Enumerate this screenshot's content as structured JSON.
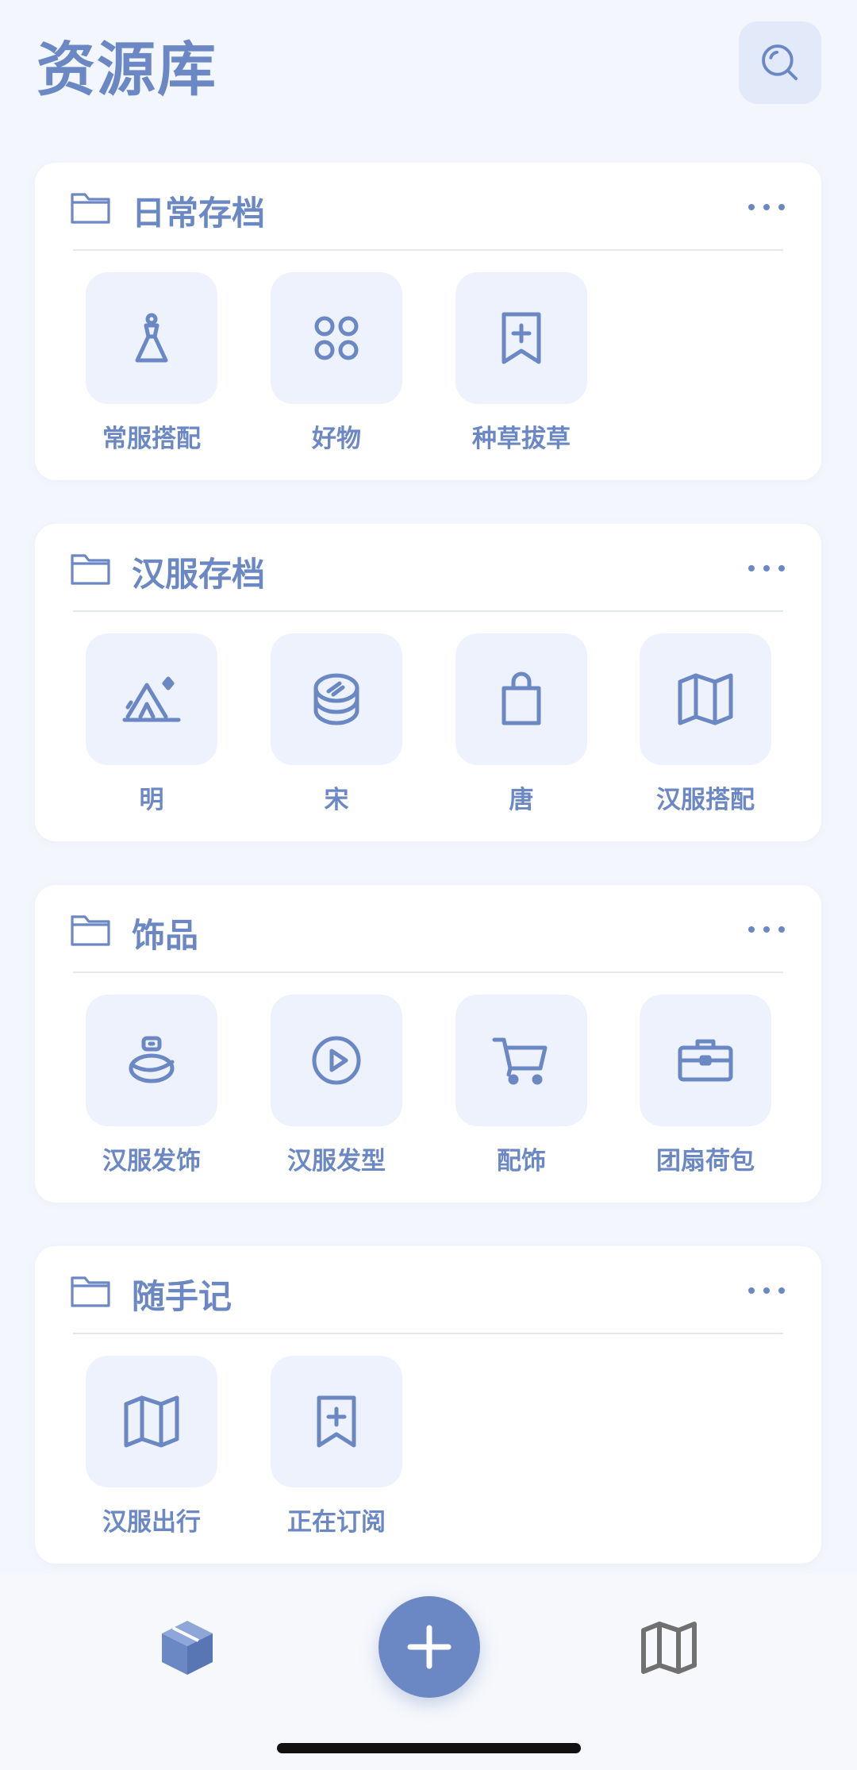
{
  "header": {
    "title": "资源库",
    "search_icon": "search-icon"
  },
  "sections": [
    {
      "title": "日常存档",
      "items": [
        {
          "label": "常服搭配",
          "icon": "dress-icon"
        },
        {
          "label": "好物",
          "icon": "grid-circles-icon"
        },
        {
          "label": "种草拔草",
          "icon": "bookmark-plus-icon"
        }
      ]
    },
    {
      "title": "汉服存档",
      "items": [
        {
          "label": "明",
          "icon": "tent-icon"
        },
        {
          "label": "宋",
          "icon": "coins-icon"
        },
        {
          "label": "唐",
          "icon": "shopping-bag-icon"
        },
        {
          "label": "汉服搭配",
          "icon": "map-icon"
        }
      ]
    },
    {
      "title": "饰品",
      "items": [
        {
          "label": "汉服发饰",
          "icon": "perfume-icon"
        },
        {
          "label": "汉服发型",
          "icon": "play-circle-icon"
        },
        {
          "label": "配饰",
          "icon": "cart-icon"
        },
        {
          "label": "团扇荷包",
          "icon": "briefcase-icon"
        }
      ]
    },
    {
      "title": "随手记",
      "items": [
        {
          "label": "汉服出行",
          "icon": "map-icon"
        },
        {
          "label": "正在订阅",
          "icon": "bookmark-plus-icon"
        }
      ]
    }
  ],
  "bottom_nav": {
    "left_icon": "box-icon",
    "center_icon": "plus-icon",
    "right_icon": "map-icon"
  },
  "colors": {
    "accent": "#6b88c4",
    "tile_bg": "#edf2fd",
    "page_bg": "#f3f6fc"
  }
}
